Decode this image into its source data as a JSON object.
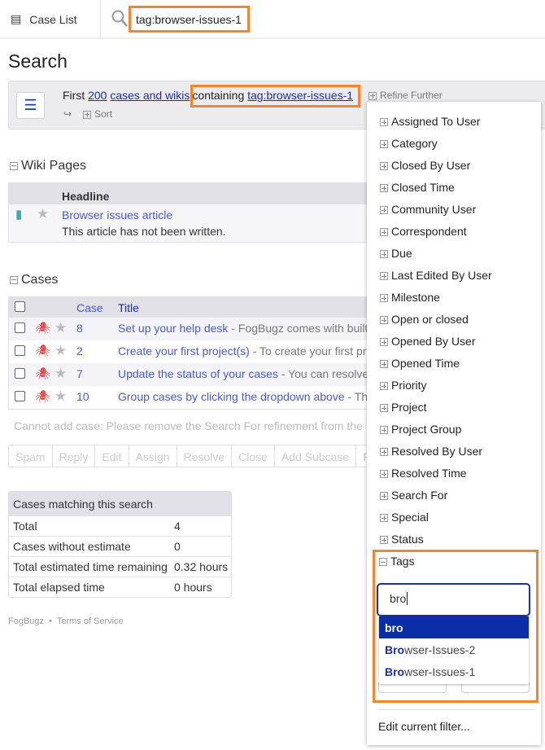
{
  "topbar": {
    "case_list_label": "Case List",
    "search_value": "tag:browser-issues-1"
  },
  "page_title": "Search",
  "filter": {
    "first": "First",
    "count": "200",
    "scope": "cases and wikis",
    "containing": "containing",
    "query": "tag:browser-issues-1",
    "refine": "Refine Further",
    "sort": "Sort"
  },
  "wiki": {
    "section_title": "Wiki Pages",
    "headline_header": "Headline",
    "rows": [
      {
        "title": "Browser issues article",
        "summary": "This article has not been written."
      }
    ]
  },
  "cases": {
    "section_title": "Cases",
    "headers": {
      "case": "Case",
      "title": "Title"
    },
    "rows": [
      {
        "id": "8",
        "title": "Set up your help desk",
        "excerpt": " - FogBugz comes with built"
      },
      {
        "id": "2",
        "title": "Create your first project(s)",
        "excerpt": " - To create your first pr"
      },
      {
        "id": "7",
        "title": "Update the status of your cases",
        "excerpt": " - You can resolve"
      },
      {
        "id": "10",
        "title": "Group cases by clicking the dropdown above",
        "excerpt": " - Th"
      }
    ],
    "cannot_add": "Cannot add case: Please remove the Search For refinement from the",
    "actions": [
      "Spam",
      "Reply",
      "Edit",
      "Assign",
      "Resolve",
      "Close",
      "Add Subcase",
      "Re"
    ]
  },
  "summary": {
    "title": "Cases matching this search",
    "rows": [
      {
        "label": "Total",
        "value": "4"
      },
      {
        "label": "Cases without estimate",
        "value": "0"
      },
      {
        "label": "Total estimated time remaining",
        "value": "0.32 hours"
      },
      {
        "label": "Total elapsed time",
        "value": "0 hours"
      }
    ]
  },
  "footer": {
    "brand": "FogBugz",
    "sep": "•",
    "terms": "Terms of Service"
  },
  "refine_panel": {
    "items": [
      "Assigned To User",
      "Category",
      "Closed By User",
      "Closed Time",
      "Community User",
      "Correspondent",
      "Due",
      "Last Edited By User",
      "Milestone",
      "Open or closed",
      "Opened By User",
      "Opened Time",
      "Priority",
      "Project",
      "Project Group",
      "Resolved By User",
      "Resolved Time",
      "Search For",
      "Special",
      "Status"
    ],
    "tags_label": "Tags",
    "tags_input": "bro",
    "suggestions": [
      {
        "match": "bro",
        "rest": ""
      },
      {
        "match": "Bro",
        "rest": "wser-Issues-2"
      },
      {
        "match": "Bro",
        "rest": "wser-Issues-1"
      }
    ],
    "edit_filter": "Edit current filter..."
  },
  "colors": {
    "highlight": "#f5842a",
    "link": "#4a5bc4",
    "selected": "#0a2ea8",
    "bug": "#e04848"
  }
}
